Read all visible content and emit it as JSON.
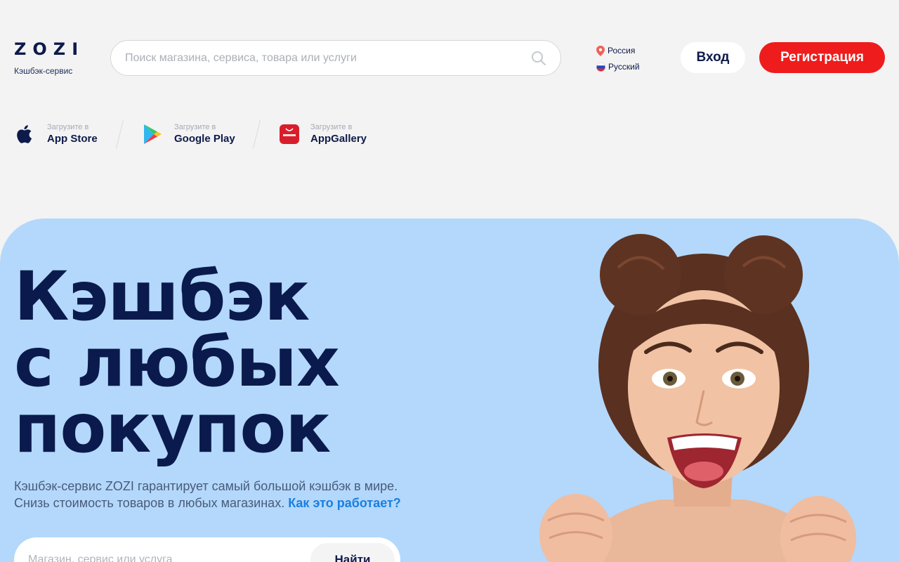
{
  "header": {
    "logo_text": "ZOZI",
    "logo_subtitle": "Кэшбэк-сервис",
    "search_placeholder": "Поиск магазина, сервиса, товара или услуги",
    "region": "Россия",
    "language": "Русский",
    "login_label": "Вход",
    "register_label": "Регистрация"
  },
  "stores": [
    {
      "small": "Загрузите в",
      "name": "App Store",
      "icon": "apple-icon"
    },
    {
      "small": "Загрузите в",
      "name": "Google Play",
      "icon": "google-play-icon"
    },
    {
      "small": "Загрузите в",
      "name": "AppGallery",
      "icon": "huawei-appgallery-icon"
    }
  ],
  "hero": {
    "title_lines": [
      "Кэшбэк",
      "с любых",
      "покупок"
    ],
    "description_line1": "Кэшбэк-сервис ZOZI гарантирует самый большой кэшбэк в мире.",
    "description_line2": "Снизь стоимость товаров в любых магазинах.",
    "description_link": "Как это работает?",
    "search_placeholder": "Магазин, сервис или услуга",
    "search_button": "Найти"
  },
  "colors": {
    "brand_navy": "#0d1a4a",
    "accent_red": "#ee1c1c",
    "hero_bg": "#b3d8fb",
    "link_blue": "#1a7fe0"
  }
}
